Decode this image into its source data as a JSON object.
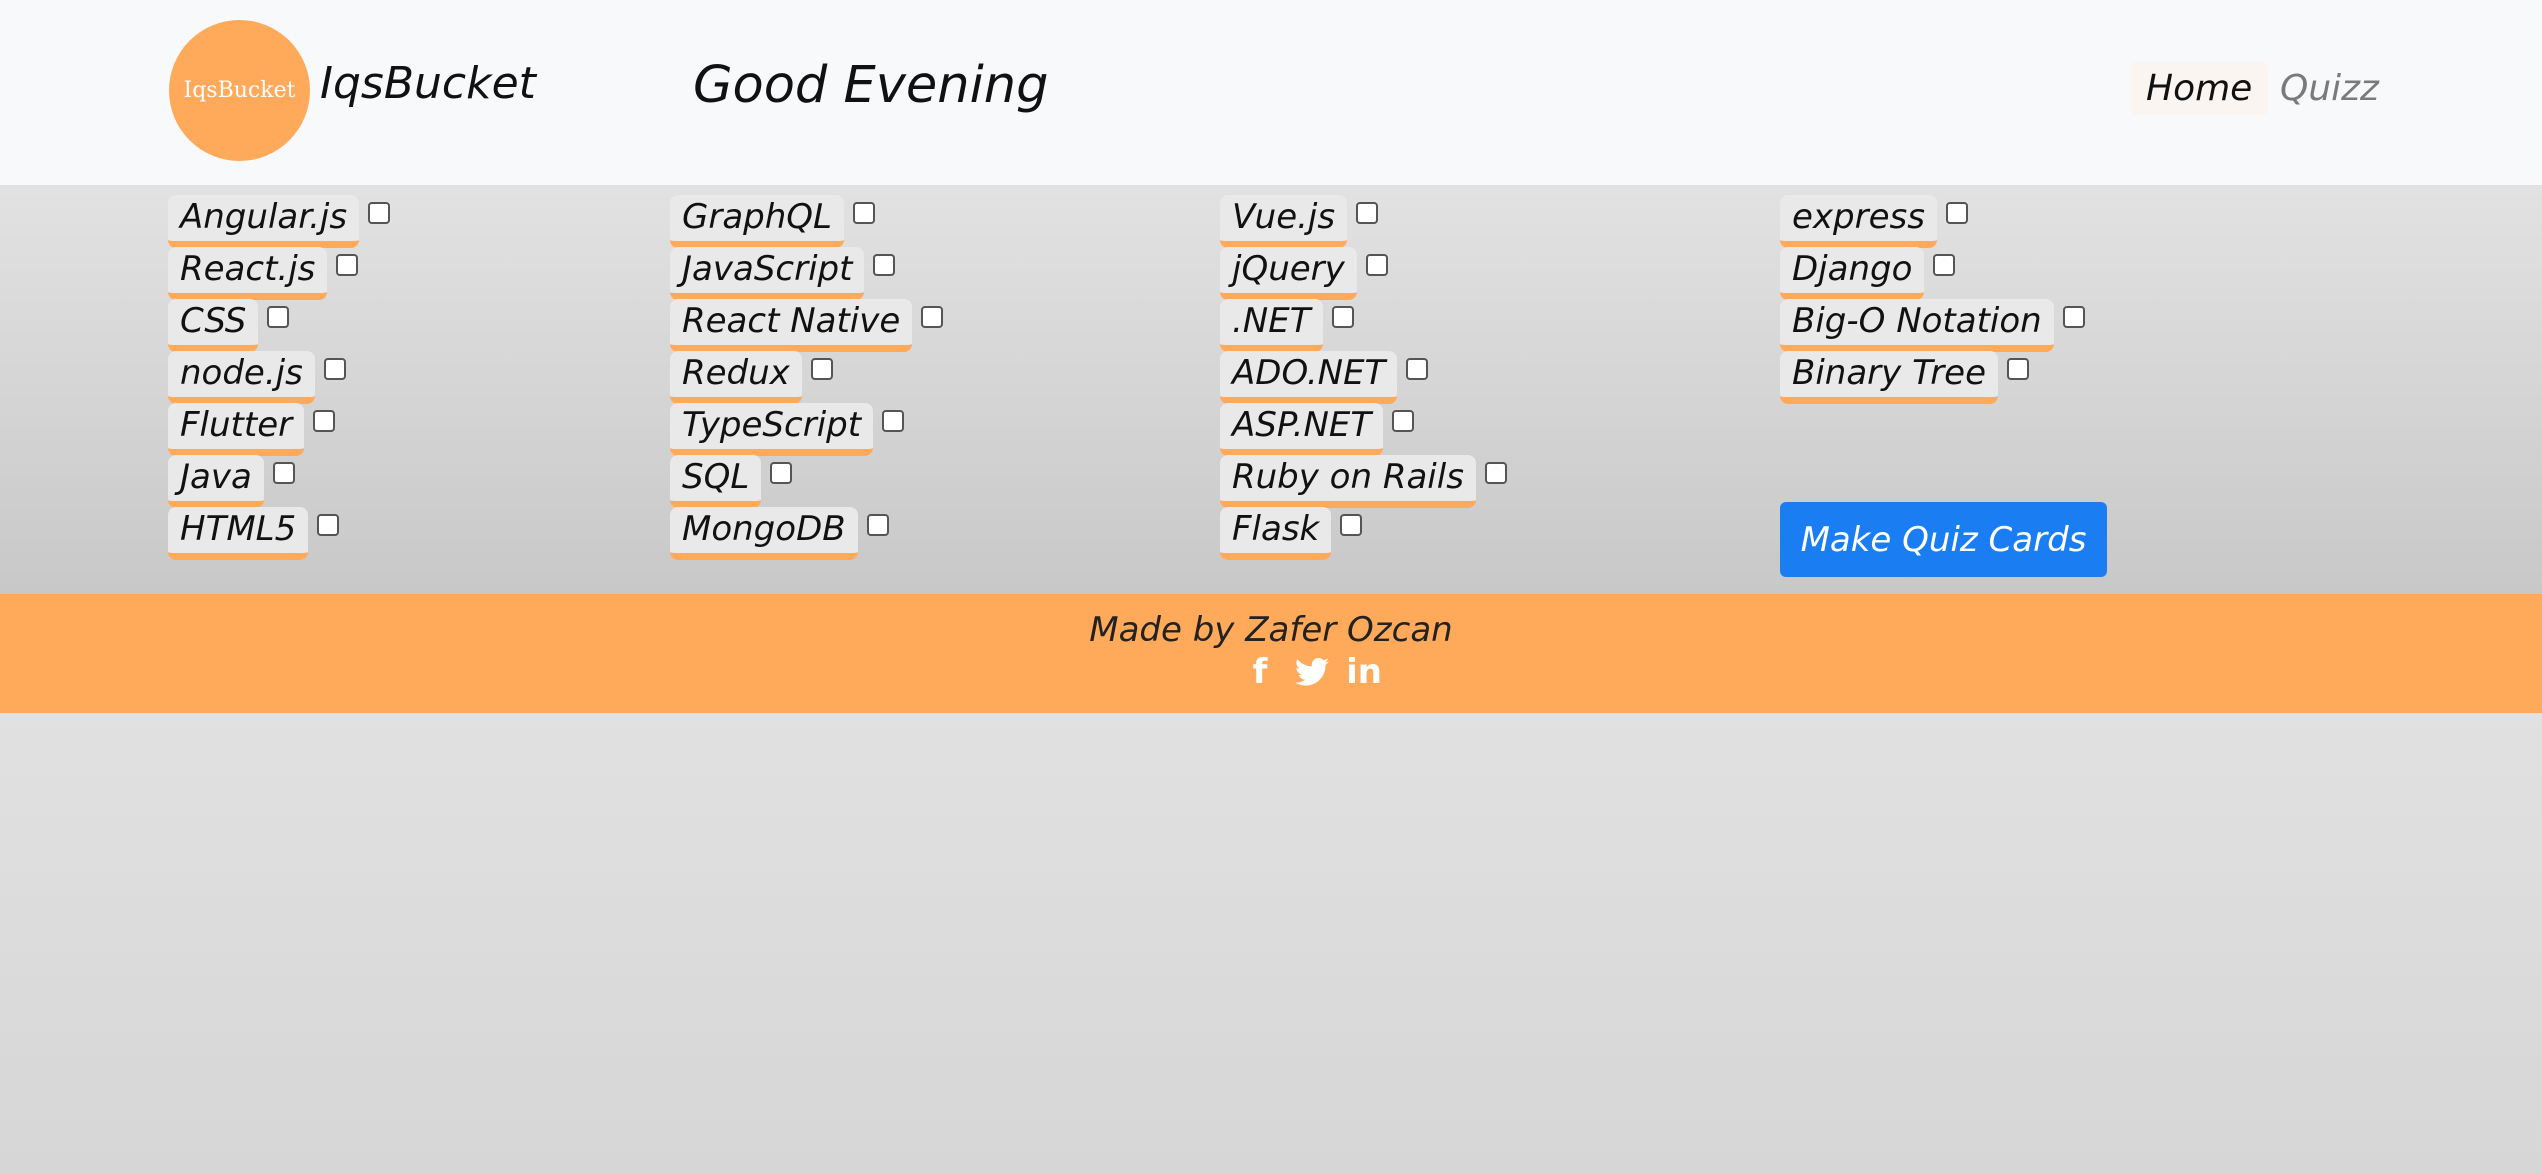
{
  "header": {
    "logo_text": "IqsBucket",
    "brand": "IqsBucket",
    "greeting": "Good Evening",
    "nav": {
      "home": "Home",
      "quizz": "Quizz"
    }
  },
  "topics": {
    "col1": [
      "Angular.js",
      "React.js",
      "CSS",
      "node.js",
      "Flutter",
      "Java",
      "HTML5"
    ],
    "col2": [
      "GraphQL",
      "JavaScript",
      "React Native",
      "Redux",
      "TypeScript",
      "SQL",
      "MongoDB"
    ],
    "col3": [
      "Vue.js",
      "jQuery",
      ".NET",
      "ADO.NET",
      "ASP.NET",
      "Ruby on Rails",
      "Flask"
    ],
    "col4": [
      "express",
      "Django",
      "Big-O Notation",
      "Binary Tree"
    ]
  },
  "make_button": "Make Quiz Cards",
  "footer": {
    "text": "Made by Zafer Ozcan",
    "icons": {
      "facebook": "f",
      "twitter": "🐦",
      "linkedin": "in"
    }
  },
  "colors": {
    "accent": "#ffa95b",
    "button": "#1a7ef2"
  }
}
